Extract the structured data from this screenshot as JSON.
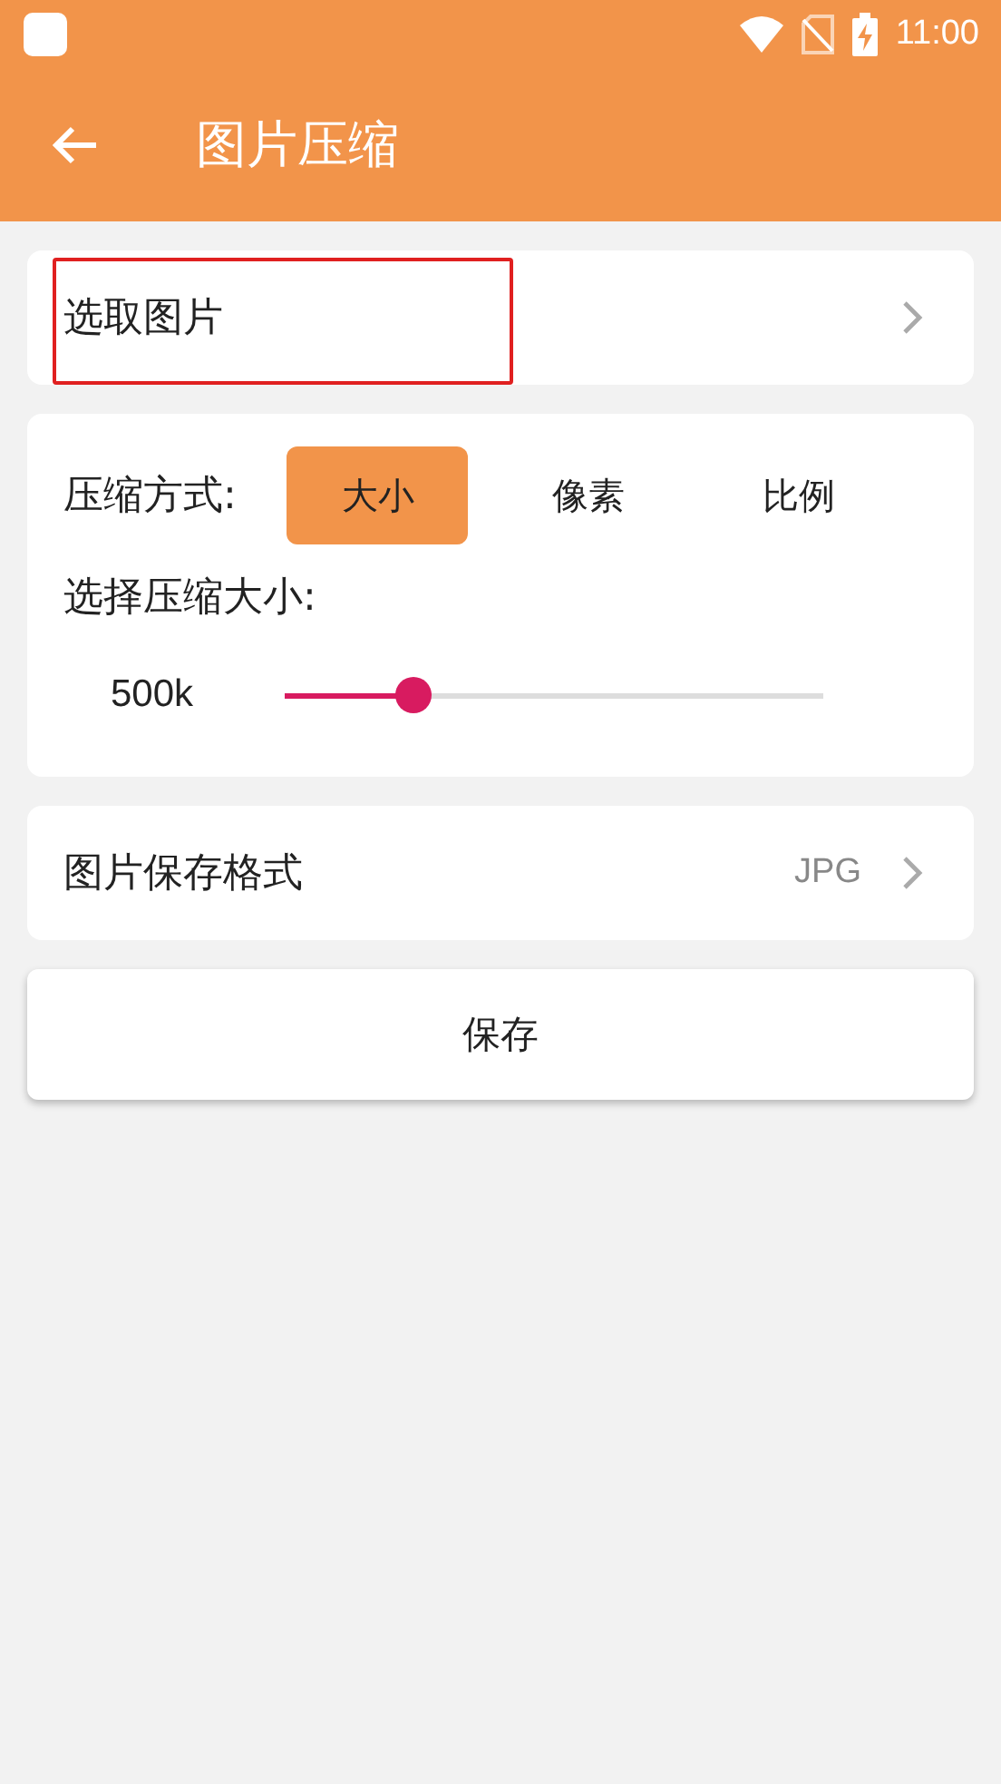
{
  "status_bar": {
    "time": "11:00"
  },
  "toolbar": {
    "title": "图片压缩"
  },
  "pick_image": {
    "label": "选取图片",
    "highlighted": true
  },
  "compression": {
    "mode_label": "压缩方式:",
    "modes": [
      {
        "label": "大小",
        "selected": true
      },
      {
        "label": "像素",
        "selected": false
      },
      {
        "label": "比例",
        "selected": false
      }
    ],
    "size_label": "选择压缩大小:",
    "size_value": "500k",
    "level": 0.24
  },
  "format": {
    "label": "图片保存格式",
    "value": "JPG"
  },
  "save_button": {
    "label": "保存"
  }
}
